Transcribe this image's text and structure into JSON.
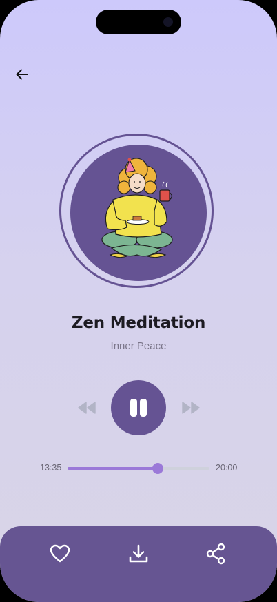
{
  "track": {
    "title": "Zen Meditation",
    "subtitle": "Inner Peace"
  },
  "progress": {
    "current": "13:35",
    "total": "20:00",
    "fraction": 0.6375
  },
  "player": {
    "state": "playing",
    "main_icon": "pause-icon"
  },
  "icons": {
    "back": "arrow-left-icon",
    "rewind": "rewind-icon",
    "forward": "fast-forward-icon",
    "favorite": "heart-icon",
    "download": "download-icon",
    "share": "share-icon"
  },
  "colors": {
    "accent": "#655393",
    "progress": "#9b79d8",
    "background_top": "#cdc9fb",
    "background_bottom": "#d8d4e6"
  }
}
